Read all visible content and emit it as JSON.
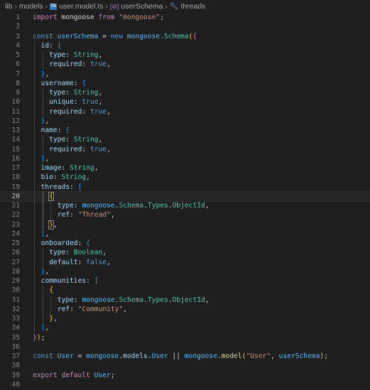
{
  "breadcrumb": {
    "items": [
      "lib",
      "models",
      "user.model.ts",
      "userSchema",
      "threads"
    ],
    "file_icon": "typescript-file-icon",
    "symbol_icons": [
      "variable-symbol-icon",
      "property-wrench-icon"
    ]
  },
  "editor": {
    "active_line": 20,
    "lines": [
      {
        "n": "1",
        "indent": 1,
        "tokens": [
          [
            "kw",
            "import"
          ],
          [
            "p",
            " mongoose "
          ],
          [
            "kw",
            "from"
          ],
          [
            "p",
            " "
          ],
          [
            "str",
            "\"mongoose\""
          ],
          [
            "p",
            ";"
          ]
        ]
      },
      {
        "n": "2",
        "indent": 0,
        "tokens": []
      },
      {
        "n": "3",
        "indent": 1,
        "tokens": [
          [
            "st",
            "const"
          ],
          [
            "p",
            " "
          ],
          [
            "var",
            "userSchema"
          ],
          [
            "p",
            " = "
          ],
          [
            "st",
            "new"
          ],
          [
            "p",
            " "
          ],
          [
            "var",
            "mongoose"
          ],
          [
            "p",
            "."
          ],
          [
            "cls",
            "Schema"
          ],
          [
            "b1",
            "("
          ],
          [
            "b2",
            "{"
          ]
        ]
      },
      {
        "n": "4",
        "indent": 2,
        "tokens": [
          [
            "prop",
            "id"
          ],
          [
            "p",
            ": "
          ],
          [
            "b3",
            "{"
          ]
        ]
      },
      {
        "n": "5",
        "indent": 3,
        "tokens": [
          [
            "prop",
            "type"
          ],
          [
            "p",
            ": "
          ],
          [
            "cls",
            "String"
          ],
          [
            "p",
            ","
          ]
        ]
      },
      {
        "n": "6",
        "indent": 3,
        "tokens": [
          [
            "prop",
            "required"
          ],
          [
            "p",
            ": "
          ],
          [
            "st",
            "true"
          ],
          [
            "p",
            ","
          ]
        ]
      },
      {
        "n": "7",
        "indent": 2,
        "tokens": [
          [
            "b3",
            "}"
          ],
          [
            "p",
            ","
          ]
        ]
      },
      {
        "n": "8",
        "indent": 2,
        "tokens": [
          [
            "prop",
            "username"
          ],
          [
            "p",
            ": "
          ],
          [
            "b3",
            "{"
          ]
        ]
      },
      {
        "n": "9",
        "indent": 3,
        "tokens": [
          [
            "prop",
            "type"
          ],
          [
            "p",
            ": "
          ],
          [
            "cls",
            "String"
          ],
          [
            "p",
            ","
          ]
        ]
      },
      {
        "n": "10",
        "indent": 3,
        "tokens": [
          [
            "prop",
            "unique"
          ],
          [
            "p",
            ": "
          ],
          [
            "st",
            "true"
          ],
          [
            "p",
            ","
          ]
        ]
      },
      {
        "n": "11",
        "indent": 3,
        "tokens": [
          [
            "prop",
            "required"
          ],
          [
            "p",
            ": "
          ],
          [
            "st",
            "true"
          ],
          [
            "p",
            ","
          ]
        ]
      },
      {
        "n": "12",
        "indent": 2,
        "tokens": [
          [
            "b3",
            "}"
          ],
          [
            "p",
            ","
          ]
        ]
      },
      {
        "n": "13",
        "indent": 2,
        "tokens": [
          [
            "prop",
            "name"
          ],
          [
            "p",
            ": "
          ],
          [
            "b3",
            "{"
          ]
        ]
      },
      {
        "n": "14",
        "indent": 3,
        "tokens": [
          [
            "prop",
            "type"
          ],
          [
            "p",
            ": "
          ],
          [
            "cls",
            "String"
          ],
          [
            "p",
            ","
          ]
        ]
      },
      {
        "n": "15",
        "indent": 3,
        "tokens": [
          [
            "prop",
            "required"
          ],
          [
            "p",
            ": "
          ],
          [
            "st",
            "true"
          ],
          [
            "p",
            ","
          ]
        ]
      },
      {
        "n": "16",
        "indent": 2,
        "tokens": [
          [
            "b3",
            "}"
          ],
          [
            "p",
            ","
          ]
        ]
      },
      {
        "n": "17",
        "indent": 2,
        "tokens": [
          [
            "prop",
            "image"
          ],
          [
            "p",
            ": "
          ],
          [
            "cls",
            "String"
          ],
          [
            "p",
            ","
          ]
        ]
      },
      {
        "n": "18",
        "indent": 2,
        "tokens": [
          [
            "prop",
            "bio"
          ],
          [
            "p",
            ": "
          ],
          [
            "cls",
            "String"
          ],
          [
            "p",
            ","
          ]
        ]
      },
      {
        "n": "19",
        "indent": 2,
        "tokens": [
          [
            "prop",
            "threads"
          ],
          [
            "p",
            ": "
          ],
          [
            "b3",
            "["
          ]
        ]
      },
      {
        "n": "20",
        "indent": 3,
        "tokens": [
          [
            "b1m",
            "{"
          ]
        ]
      },
      {
        "n": "21",
        "indent": 4,
        "tokens": [
          [
            "prop",
            "type"
          ],
          [
            "p",
            ": "
          ],
          [
            "var",
            "mongoose"
          ],
          [
            "p",
            "."
          ],
          [
            "cls",
            "Schema"
          ],
          [
            "p",
            "."
          ],
          [
            "cls",
            "Types"
          ],
          [
            "p",
            "."
          ],
          [
            "cls",
            "ObjectId"
          ],
          [
            "p",
            ","
          ]
        ]
      },
      {
        "n": "22",
        "indent": 4,
        "tokens": [
          [
            "prop",
            "ref"
          ],
          [
            "p",
            ": "
          ],
          [
            "str",
            "\"Thread\""
          ],
          [
            "p",
            ","
          ]
        ]
      },
      {
        "n": "23",
        "indent": 3,
        "tokens": [
          [
            "b1m",
            "}"
          ],
          [
            "p",
            ","
          ]
        ]
      },
      {
        "n": "24",
        "indent": 2,
        "tokens": [
          [
            "b3",
            "]"
          ],
          [
            "p",
            ","
          ]
        ]
      },
      {
        "n": "25",
        "indent": 2,
        "tokens": [
          [
            "prop",
            "onboarded"
          ],
          [
            "p",
            ": "
          ],
          [
            "b3",
            "{"
          ]
        ]
      },
      {
        "n": "26",
        "indent": 3,
        "tokens": [
          [
            "prop",
            "type"
          ],
          [
            "p",
            ": "
          ],
          [
            "cls",
            "Boolean"
          ],
          [
            "p",
            ","
          ]
        ]
      },
      {
        "n": "27",
        "indent": 3,
        "tokens": [
          [
            "prop",
            "default"
          ],
          [
            "p",
            ": "
          ],
          [
            "st",
            "false"
          ],
          [
            "p",
            ","
          ]
        ]
      },
      {
        "n": "28",
        "indent": 2,
        "tokens": [
          [
            "b3",
            "}"
          ],
          [
            "p",
            ","
          ]
        ]
      },
      {
        "n": "29",
        "indent": 2,
        "tokens": [
          [
            "prop",
            "communities"
          ],
          [
            "p",
            ": "
          ],
          [
            "b3",
            "["
          ]
        ]
      },
      {
        "n": "30",
        "indent": 3,
        "tokens": [
          [
            "b1",
            "{"
          ]
        ]
      },
      {
        "n": "31",
        "indent": 4,
        "tokens": [
          [
            "prop",
            "type"
          ],
          [
            "p",
            ": "
          ],
          [
            "var",
            "mongoose"
          ],
          [
            "p",
            "."
          ],
          [
            "cls",
            "Schema"
          ],
          [
            "p",
            "."
          ],
          [
            "cls",
            "Types"
          ],
          [
            "p",
            "."
          ],
          [
            "cls",
            "ObjectId"
          ],
          [
            "p",
            ","
          ]
        ]
      },
      {
        "n": "32",
        "indent": 4,
        "tokens": [
          [
            "prop",
            "ref"
          ],
          [
            "p",
            ": "
          ],
          [
            "str",
            "\"Community\""
          ],
          [
            "p",
            ","
          ]
        ]
      },
      {
        "n": "33",
        "indent": 3,
        "tokens": [
          [
            "b1",
            "}"
          ],
          [
            "p",
            ","
          ]
        ]
      },
      {
        "n": "34",
        "indent": 2,
        "tokens": [
          [
            "b3",
            "]"
          ],
          [
            "p",
            ","
          ]
        ]
      },
      {
        "n": "35",
        "indent": 1,
        "tokens": [
          [
            "b2",
            "}"
          ],
          [
            "b1",
            ")"
          ],
          [
            "p",
            ";"
          ]
        ]
      },
      {
        "n": "36",
        "indent": 0,
        "tokens": []
      },
      {
        "n": "37",
        "indent": 1,
        "tokens": [
          [
            "st",
            "const"
          ],
          [
            "p",
            " "
          ],
          [
            "var",
            "User"
          ],
          [
            "p",
            " = "
          ],
          [
            "var",
            "mongoose"
          ],
          [
            "p",
            "."
          ],
          [
            "prop",
            "models"
          ],
          [
            "p",
            "."
          ],
          [
            "var",
            "User"
          ],
          [
            "p",
            " || "
          ],
          [
            "var",
            "mongoose"
          ],
          [
            "p",
            "."
          ],
          [
            "fn",
            "model"
          ],
          [
            "b1",
            "("
          ],
          [
            "str",
            "\"User\""
          ],
          [
            "p",
            ", "
          ],
          [
            "var",
            "userSchema"
          ],
          [
            "b1",
            ")"
          ],
          [
            "p",
            ";"
          ]
        ]
      },
      {
        "n": "38",
        "indent": 0,
        "tokens": []
      },
      {
        "n": "39",
        "indent": 1,
        "tokens": [
          [
            "kw",
            "export"
          ],
          [
            "p",
            " "
          ],
          [
            "kw",
            "default"
          ],
          [
            "p",
            " "
          ],
          [
            "var",
            "User"
          ],
          [
            "p",
            ";"
          ]
        ]
      },
      {
        "n": "40",
        "indent": 0,
        "tokens": []
      }
    ]
  }
}
